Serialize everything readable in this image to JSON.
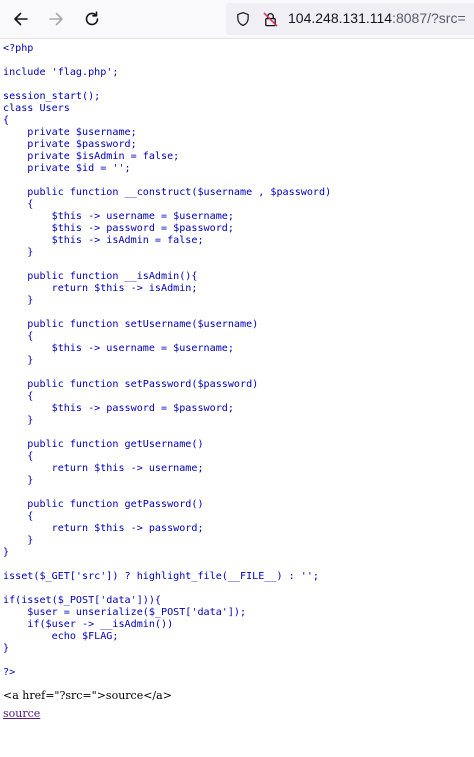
{
  "browser": {
    "back_icon": "arrow-left-icon",
    "forward_icon": "arrow-right-icon",
    "reload_icon": "reload-icon",
    "tracking_icon": "shield-icon",
    "insecure_icon": "insecure-lock-icon",
    "url_host": "104.248.131.114",
    "url_rest": ":8087/?src="
  },
  "code_lines": [
    "<?php",
    "",
    "include 'flag.php';",
    "",
    "session_start();",
    "class Users",
    "{",
    "    private $username;",
    "    private $password;",
    "    private $isAdmin = false;",
    "    private $id = '';",
    "",
    "    public function __construct($username , $password)",
    "    {",
    "        $this -> username = $username;",
    "        $this -> password = $password;",
    "        $this -> isAdmin = false;",
    "    }",
    "",
    "    public function __isAdmin(){",
    "        return $this -> isAdmin;",
    "    }",
    "",
    "    public function setUsername($username)",
    "    {",
    "        $this -> username = $username;",
    "    }",
    "",
    "    public function setPassword($password)",
    "    {",
    "        $this -> password = $password;",
    "    }",
    "",
    "    public function getUsername()",
    "    {",
    "        return $this -> username;",
    "    }",
    "",
    "    public function getPassword()",
    "    {",
    "        return $this -> password;",
    "    }",
    "}",
    "",
    "isset($_GET['src']) ? highlight_file(__FILE__) : '';",
    "",
    "if(isset($_POST['data'])){",
    "    $user = unserialize($_POST['data']);",
    "    if($user -> __isAdmin())",
    "        echo $FLAG;",
    "}",
    "",
    "?>"
  ],
  "footer": {
    "raw_tag": "<a href=\"?src=\">source</a>",
    "link_label": "source"
  }
}
